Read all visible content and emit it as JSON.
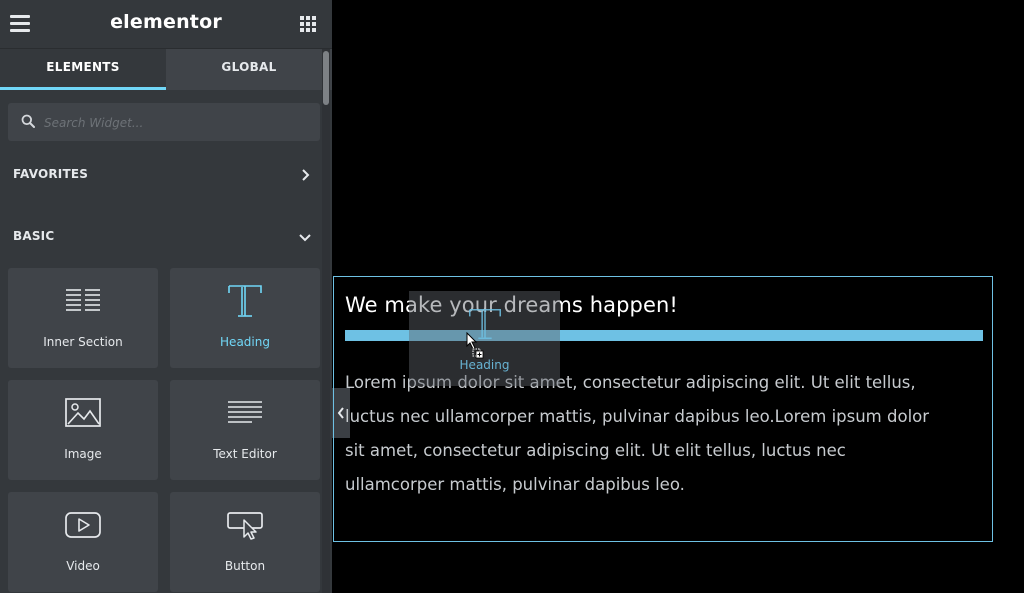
{
  "header": {
    "logo": "elementor",
    "menu_icon": "hamburger-icon",
    "apps_icon": "grid-icon"
  },
  "tabs": [
    {
      "label": "ELEMENTS",
      "active": true
    },
    {
      "label": "GLOBAL",
      "active": false
    }
  ],
  "search": {
    "placeholder": "Search Widget...",
    "value": "",
    "icon": "search-icon"
  },
  "categories": {
    "favorites": {
      "title": "FAVORITES",
      "icon": "chevron-right-icon"
    },
    "basic": {
      "title": "BASIC",
      "icon": "chevron-down-icon"
    }
  },
  "widgets": [
    {
      "label": "Inner Section",
      "icon": "inner-section-icon"
    },
    {
      "label": "Heading",
      "icon": "heading-icon"
    },
    {
      "label": "Image",
      "icon": "image-icon"
    },
    {
      "label": "Text Editor",
      "icon": "text-editor-icon"
    },
    {
      "label": "Video",
      "icon": "video-icon"
    },
    {
      "label": "Button",
      "icon": "button-icon"
    }
  ],
  "canvas": {
    "heading": "We make your dreams happen!",
    "body_lines": [
      "Lorem ipsum dolor sit amet, consectetur adipiscing elit. Ut elit tellus,",
      "luctus nec ullamcorper mattis, pulvinar dapibus leo.Lorem ipsum dolor",
      "sit amet, consectetur adipiscing elit. Ut elit tellus, luctus nec",
      "ullamcorper mattis, pulvinar dapibus leo."
    ]
  },
  "drag_ghost": {
    "label": "Heading",
    "icon": "heading-icon"
  },
  "colors": {
    "accent": "#71d7f7",
    "panel": "#34383c",
    "widget": "#404449",
    "canvas": "#000000",
    "divider": "#6ec1e4"
  }
}
